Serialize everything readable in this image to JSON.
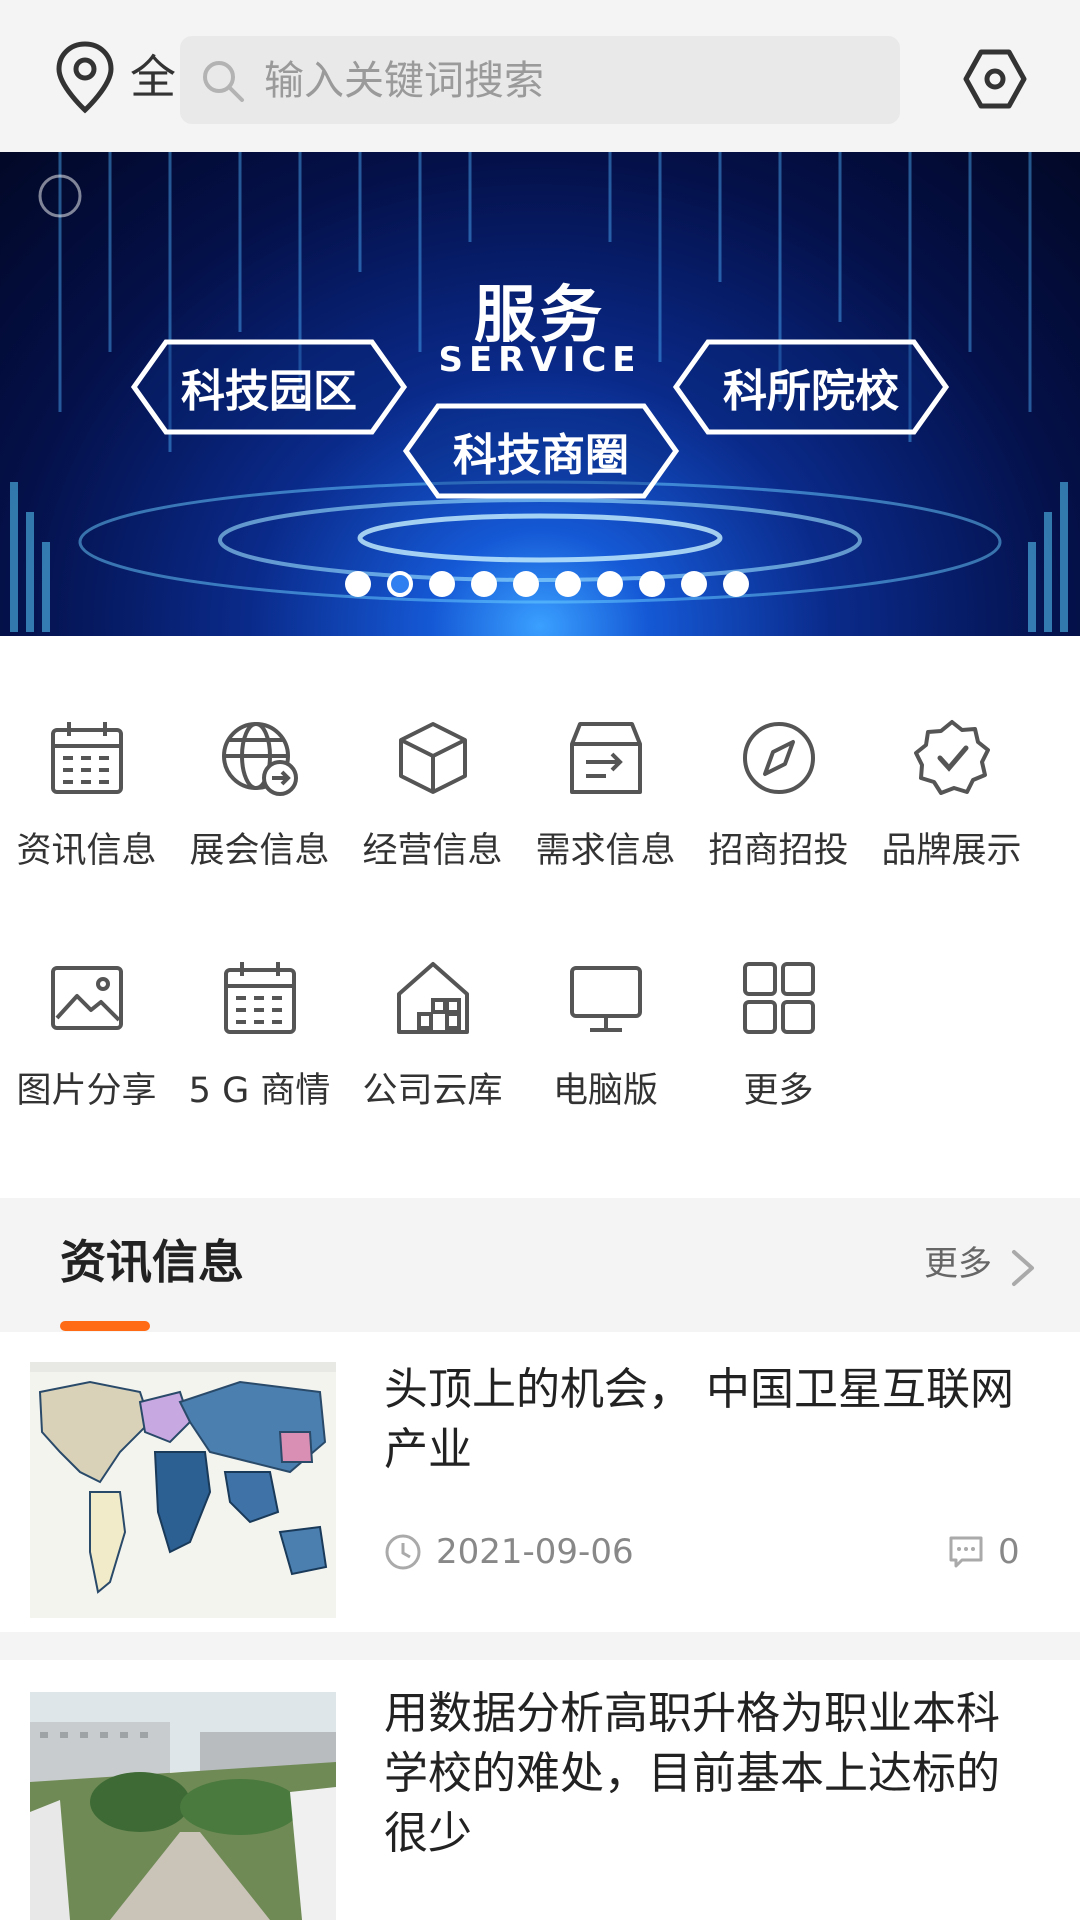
{
  "header": {
    "location_label": "全",
    "search_placeholder": "输入关键词搜索",
    "icons": [
      "location-pin-icon",
      "search-icon",
      "settings-hex-icon"
    ]
  },
  "banner": {
    "title": "服务",
    "subtitle": "SERVICE",
    "labels": [
      "科技园区",
      "科技商圈",
      "科所院校"
    ],
    "slide_count": 10,
    "active_slide": 2
  },
  "menu": {
    "row1": [
      {
        "label": "资讯信息",
        "icon": "calendar-icon"
      },
      {
        "label": "展会信息",
        "icon": "globe-icon"
      },
      {
        "label": "经营信息",
        "icon": "box-icon"
      },
      {
        "label": "需求信息",
        "icon": "inbox-icon"
      },
      {
        "label": "招商招投",
        "icon": "compass-icon"
      },
      {
        "label": "品牌展示",
        "icon": "badge-check-icon"
      }
    ],
    "row2": [
      {
        "label": "图片分享",
        "icon": "image-icon"
      },
      {
        "label": "5 G 商情",
        "icon": "calendar-icon"
      },
      {
        "label": "公司云库",
        "icon": "house-icon"
      },
      {
        "label": "电脑版",
        "icon": "monitor-icon"
      },
      {
        "label": "更多",
        "icon": "grid-icon"
      }
    ]
  },
  "section": {
    "title": "资讯信息",
    "more_label": "更多"
  },
  "news": [
    {
      "title": "头顶上的机会， 中国卫星互联网产业",
      "date": "2021-09-06",
      "comments": "0"
    },
    {
      "title": "用数据分析高职升格为职业本科学校的难处，目前基本上达标的很少"
    }
  ],
  "colors": {
    "accent": "#ff6a14",
    "active_dot": "#2f7ff0",
    "background_gray": "#f4f4f4"
  }
}
